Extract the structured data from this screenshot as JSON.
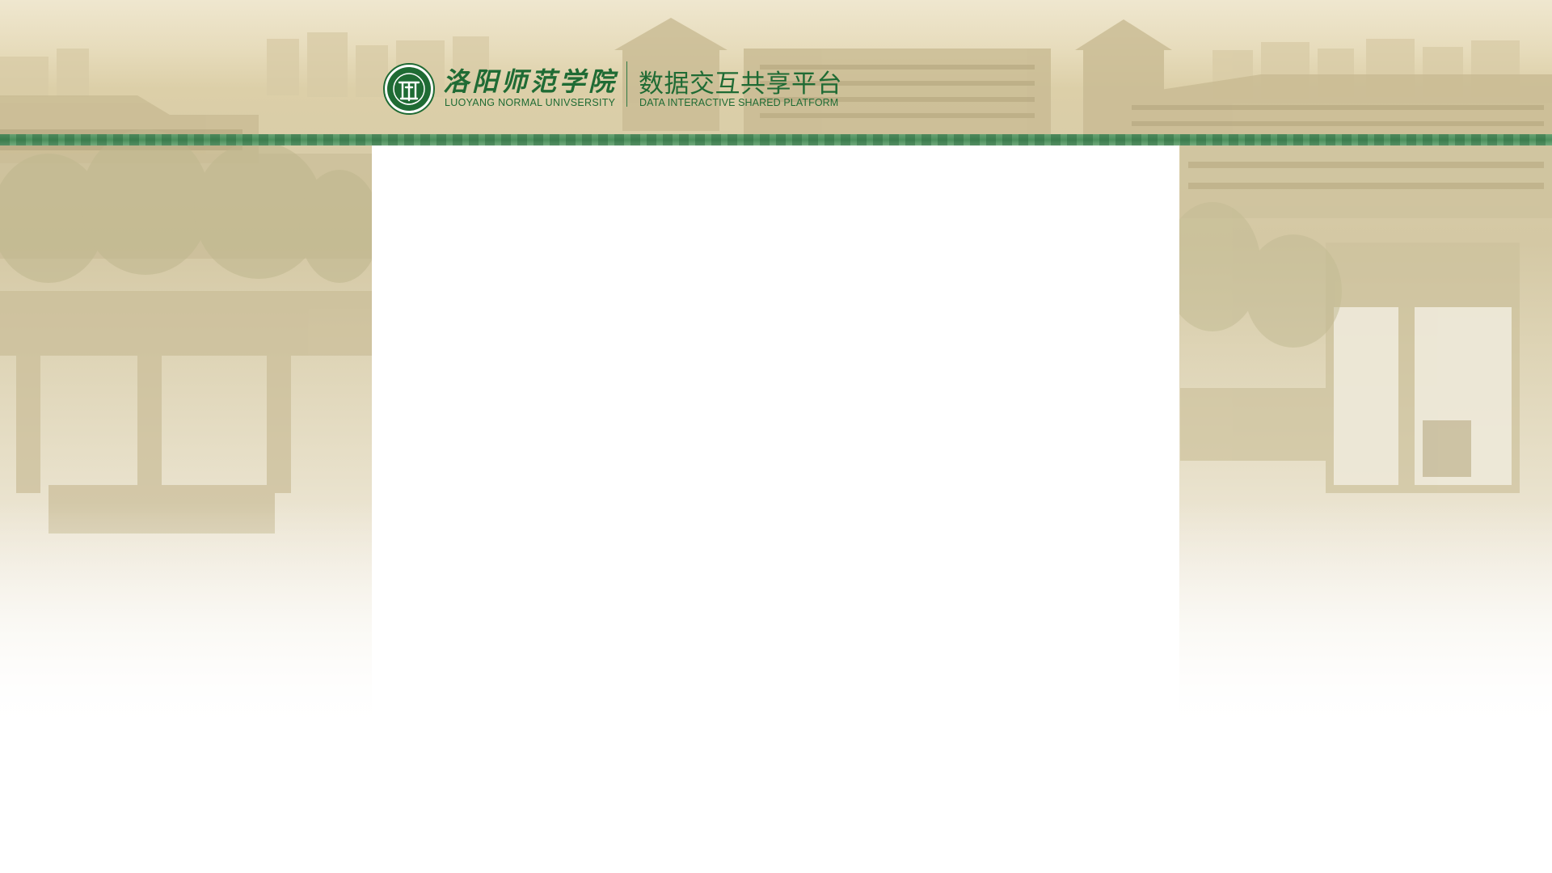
{
  "header": {
    "university_name_cn": "洛阳师范学院",
    "university_name_en": "LUOYANG NORMAL UNIVSERSITY",
    "platform_name_cn": "数据交互共享平台",
    "platform_name_en": "DATA INTERACTIVE SHARED PLATFORM",
    "logo_icon": "university-seal-icon"
  },
  "theme": {
    "brand_green": "#1f6b34",
    "band_green": "#3f8a56",
    "background_tone": "#e7dcbc",
    "panel_color": "#ffffff"
  },
  "content_panel": {
    "state": "empty"
  }
}
